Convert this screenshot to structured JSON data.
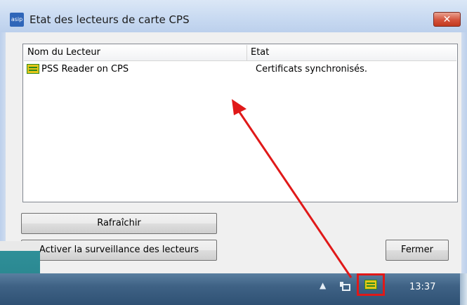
{
  "window": {
    "title": "Etat des lecteurs de carte CPS",
    "app_icon_text": "asip",
    "close_glyph": "✕"
  },
  "list": {
    "columns": [
      "Nom du Lecteur",
      "Etat"
    ],
    "rows": [
      {
        "icon": "card-reader-icon",
        "name": "PSS Reader on CPS",
        "status": "Certificats synchronisés."
      }
    ]
  },
  "buttons": {
    "refresh": "Rafraîchir",
    "watch": "Activer la surveillance des lecteurs",
    "close": "Fermer"
  },
  "taskbar": {
    "tray_arrow": "▲",
    "clock": "13:37"
  },
  "colors": {
    "annotation": "#e01919"
  }
}
